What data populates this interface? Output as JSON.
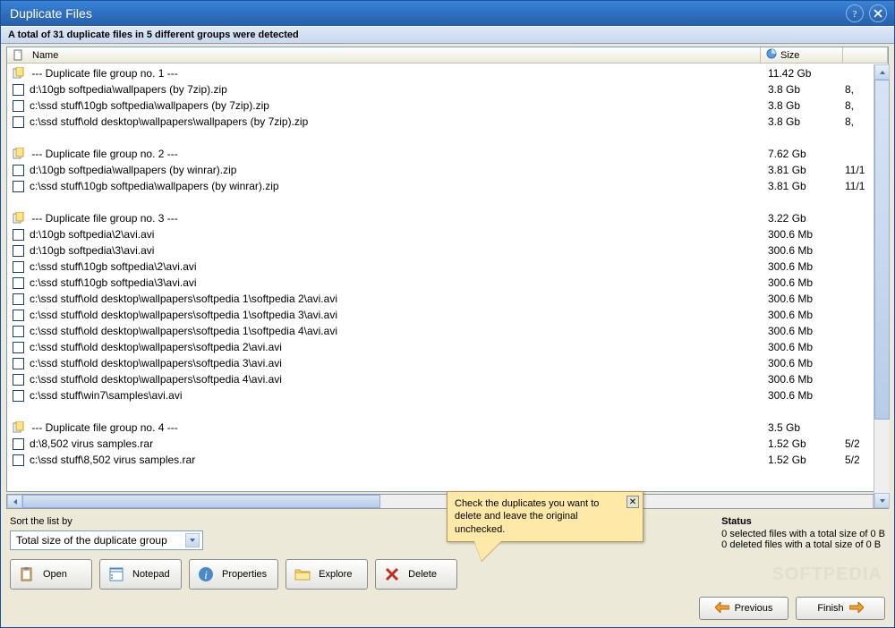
{
  "title": "Duplicate Files",
  "summary": "A total of 31 duplicate files in 5 different groups were detected",
  "columns": {
    "name": "Name",
    "size": "Size"
  },
  "rows": [
    {
      "type": "group",
      "name": "--- Duplicate file group no. 1 ---",
      "size": "11.42 Gb",
      "date": ""
    },
    {
      "type": "file",
      "name": "d:\\10gb softpedia\\wallpapers (by 7zip).zip",
      "size": "3.8 Gb",
      "date": "8,"
    },
    {
      "type": "file",
      "name": "c:\\ssd stuff\\10gb softpedia\\wallpapers (by 7zip).zip",
      "size": "3.8 Gb",
      "date": "8,"
    },
    {
      "type": "file",
      "name": "c:\\ssd stuff\\old desktop\\wallpapers\\wallpapers (by 7zip).zip",
      "size": "3.8 Gb",
      "date": "8,"
    },
    {
      "type": "spacer"
    },
    {
      "type": "group",
      "name": "--- Duplicate file group no. 2 ---",
      "size": "7.62 Gb",
      "date": ""
    },
    {
      "type": "file",
      "name": "d:\\10gb softpedia\\wallpapers (by winrar).zip",
      "size": "3.81 Gb",
      "date": "11/1"
    },
    {
      "type": "file",
      "name": "c:\\ssd stuff\\10gb softpedia\\wallpapers (by winrar).zip",
      "size": "3.81 Gb",
      "date": "11/1"
    },
    {
      "type": "spacer"
    },
    {
      "type": "group",
      "name": "--- Duplicate file group no. 3 ---",
      "size": "3.22 Gb",
      "date": ""
    },
    {
      "type": "file",
      "name": "d:\\10gb softpedia\\2\\avi.avi",
      "size": "300.6 Mb",
      "date": ""
    },
    {
      "type": "file",
      "name": "d:\\10gb softpedia\\3\\avi.avi",
      "size": "300.6 Mb",
      "date": ""
    },
    {
      "type": "file",
      "name": "c:\\ssd stuff\\10gb softpedia\\2\\avi.avi",
      "size": "300.6 Mb",
      "date": ""
    },
    {
      "type": "file",
      "name": "c:\\ssd stuff\\10gb softpedia\\3\\avi.avi",
      "size": "300.6 Mb",
      "date": ""
    },
    {
      "type": "file",
      "name": "c:\\ssd stuff\\old desktop\\wallpapers\\softpedia 1\\softpedia 2\\avi.avi",
      "size": "300.6 Mb",
      "date": ""
    },
    {
      "type": "file",
      "name": "c:\\ssd stuff\\old desktop\\wallpapers\\softpedia 1\\softpedia 3\\avi.avi",
      "size": "300.6 Mb",
      "date": ""
    },
    {
      "type": "file",
      "name": "c:\\ssd stuff\\old desktop\\wallpapers\\softpedia 1\\softpedia 4\\avi.avi",
      "size": "300.6 Mb",
      "date": ""
    },
    {
      "type": "file",
      "name": "c:\\ssd stuff\\old desktop\\wallpapers\\softpedia 2\\avi.avi",
      "size": "300.6 Mb",
      "date": ""
    },
    {
      "type": "file",
      "name": "c:\\ssd stuff\\old desktop\\wallpapers\\softpedia 3\\avi.avi",
      "size": "300.6 Mb",
      "date": ""
    },
    {
      "type": "file",
      "name": "c:\\ssd stuff\\old desktop\\wallpapers\\softpedia 4\\avi.avi",
      "size": "300.6 Mb",
      "date": ""
    },
    {
      "type": "file",
      "name": "c:\\ssd stuff\\win7\\samples\\avi.avi",
      "size": "300.6 Mb",
      "date": ""
    },
    {
      "type": "spacer"
    },
    {
      "type": "group",
      "name": "--- Duplicate file group no. 4 ---",
      "size": "3.5 Gb",
      "date": ""
    },
    {
      "type": "file",
      "name": "d:\\8,502 virus samples.rar",
      "size": "1.52 Gb",
      "date": "5/2"
    },
    {
      "type": "file",
      "name": "c:\\ssd stuff\\8,502 virus samples.rar",
      "size": "1.52 Gb",
      "date": "5/2"
    }
  ],
  "sort": {
    "label": "Sort the list by",
    "value": "Total size of the duplicate group"
  },
  "status": {
    "title": "Status",
    "line1": "0 selected files with a total size of 0 B",
    "line2": "0 deleted files with a total size of 0 B"
  },
  "buttons": {
    "open": "Open",
    "notepad": "Notepad",
    "properties": "Properties",
    "explore": "Explore",
    "delete": "Delete",
    "previous": "Previous",
    "finish": "Finish"
  },
  "tooltip": "Check the duplicates you want to delete and leave the original unchecked.",
  "watermark": "SOFTPEDIA"
}
